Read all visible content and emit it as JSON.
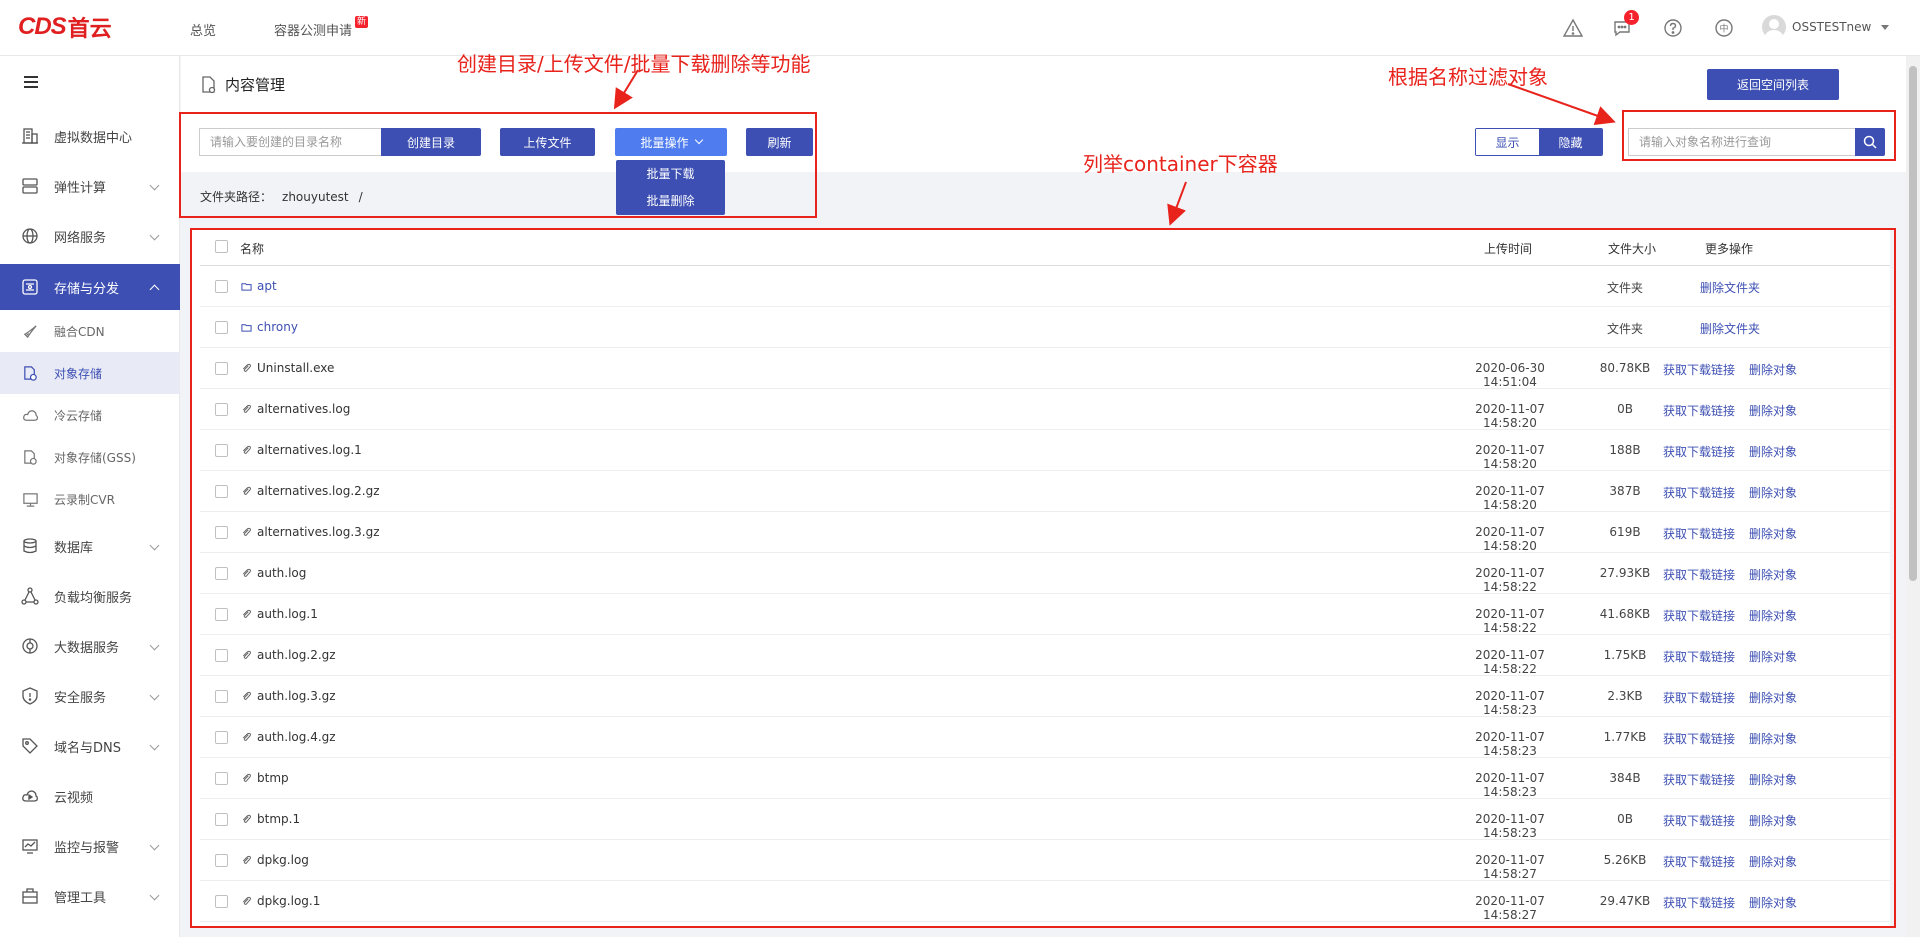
{
  "brand": {
    "logo_text": "CDS",
    "logo_cn": "首云"
  },
  "topnav": {
    "overview": "总览",
    "container_beta": "容器公测申请",
    "new_badge": "新"
  },
  "header_icons": {
    "message_count": "1",
    "lang": "中"
  },
  "user": {
    "name": "OSSTESTnew"
  },
  "sidebar": {
    "items": [
      {
        "label": "虚拟数据中心",
        "icon": "building-icon"
      },
      {
        "label": "弹性计算",
        "icon": "server-icon"
      },
      {
        "label": "网络服务",
        "icon": "globe-icon"
      },
      {
        "label": "存储与分发",
        "icon": "storage-icon"
      },
      {
        "label": "数据库",
        "icon": "database-icon"
      },
      {
        "label": "负载均衡服务",
        "icon": "network-icon"
      },
      {
        "label": "大数据服务",
        "icon": "bigdata-icon"
      },
      {
        "label": "安全服务",
        "icon": "shield-icon"
      },
      {
        "label": "域名与DNS",
        "icon": "tag-icon"
      },
      {
        "label": "云视频",
        "icon": "video-icon"
      },
      {
        "label": "监控与报警",
        "icon": "monitor-icon"
      },
      {
        "label": "管理工具",
        "icon": "toolbox-icon"
      }
    ],
    "sub_items": [
      {
        "label": "融合CDN",
        "icon": "rocket-icon"
      },
      {
        "label": "对象存储",
        "icon": "object-storage-icon"
      },
      {
        "label": "冷云存储",
        "icon": "cloud-icon"
      },
      {
        "label": "对象存储(GSS)",
        "icon": "object-storage-gss-icon"
      },
      {
        "label": "云录制CVR",
        "icon": "cvr-icon"
      }
    ]
  },
  "page": {
    "title": "内容管理",
    "back_label": "返回空间列表"
  },
  "toolbar": {
    "dir_placeholder": "请输入要创建的目录名称",
    "mkdir_label": "创建目录",
    "upload_label": "上传文件",
    "batch_label": "批量操作",
    "refresh_label": "刷新",
    "show_label": "显示",
    "hide_label": "隐藏",
    "search_placeholder": "请输入对象名称进行查询",
    "batch_menu": [
      "批量下载",
      "批量删除"
    ]
  },
  "path": {
    "label": "文件夹路径：",
    "value": "zhouyutest",
    "sep": "/"
  },
  "table": {
    "headers": {
      "name": "名称",
      "time": "上传时间",
      "size": "文件大小",
      "ops": "更多操作"
    },
    "rows": [
      {
        "name": "apt",
        "type": "folder",
        "time": "",
        "size": "文件夹",
        "ops": [
          "删除文件夹"
        ]
      },
      {
        "name": "chrony",
        "type": "folder",
        "time": "",
        "size": "文件夹",
        "ops": [
          "删除文件夹"
        ]
      },
      {
        "name": "Uninstall.exe",
        "type": "file",
        "time": "2020-06-30 14:51:04",
        "size": "80.78KB",
        "ops": [
          "获取下载链接",
          "删除对象"
        ]
      },
      {
        "name": "alternatives.log",
        "type": "file",
        "time": "2020-11-07 14:58:20",
        "size": "0B",
        "ops": [
          "获取下载链接",
          "删除对象"
        ]
      },
      {
        "name": "alternatives.log.1",
        "type": "file",
        "time": "2020-11-07 14:58:20",
        "size": "188B",
        "ops": [
          "获取下载链接",
          "删除对象"
        ]
      },
      {
        "name": "alternatives.log.2.gz",
        "type": "file",
        "time": "2020-11-07 14:58:20",
        "size": "387B",
        "ops": [
          "获取下载链接",
          "删除对象"
        ]
      },
      {
        "name": "alternatives.log.3.gz",
        "type": "file",
        "time": "2020-11-07 14:58:20",
        "size": "619B",
        "ops": [
          "获取下载链接",
          "删除对象"
        ]
      },
      {
        "name": "auth.log",
        "type": "file",
        "time": "2020-11-07 14:58:22",
        "size": "27.93KB",
        "ops": [
          "获取下载链接",
          "删除对象"
        ]
      },
      {
        "name": "auth.log.1",
        "type": "file",
        "time": "2020-11-07 14:58:22",
        "size": "41.68KB",
        "ops": [
          "获取下载链接",
          "删除对象"
        ]
      },
      {
        "name": "auth.log.2.gz",
        "type": "file",
        "time": "2020-11-07 14:58:22",
        "size": "1.75KB",
        "ops": [
          "获取下载链接",
          "删除对象"
        ]
      },
      {
        "name": "auth.log.3.gz",
        "type": "file",
        "time": "2020-11-07 14:58:23",
        "size": "2.3KB",
        "ops": [
          "获取下载链接",
          "删除对象"
        ]
      },
      {
        "name": "auth.log.4.gz",
        "type": "file",
        "time": "2020-11-07 14:58:23",
        "size": "1.77KB",
        "ops": [
          "获取下载链接",
          "删除对象"
        ]
      },
      {
        "name": "btmp",
        "type": "file",
        "time": "2020-11-07 14:58:23",
        "size": "384B",
        "ops": [
          "获取下载链接",
          "删除对象"
        ]
      },
      {
        "name": "btmp.1",
        "type": "file",
        "time": "2020-11-07 14:58:23",
        "size": "0B",
        "ops": [
          "获取下载链接",
          "删除对象"
        ]
      },
      {
        "name": "dpkg.log",
        "type": "file",
        "time": "2020-11-07 14:58:27",
        "size": "5.26KB",
        "ops": [
          "获取下载链接",
          "删除对象"
        ]
      },
      {
        "name": "dpkg.log.1",
        "type": "file",
        "time": "2020-11-07 14:58:27",
        "size": "29.47KB",
        "ops": [
          "获取下载链接",
          "删除对象"
        ]
      }
    ]
  },
  "annotations": {
    "toolbar_note": "创建目录/上传文件/批量下载删除等功能",
    "filter_note": "根据名称过滤对象",
    "list_note": "列举container下容器"
  },
  "colors": {
    "accent": "#3d4fb3",
    "annotation": "#e8231c",
    "batch": "#4f7df0"
  }
}
